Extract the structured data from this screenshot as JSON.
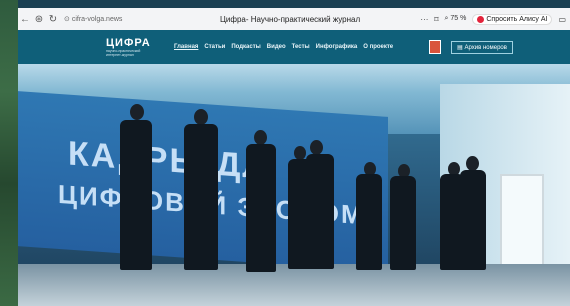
{
  "browser": {
    "address": "cifra-volga.news",
    "tab_title": "Цифра- Научно-практический журнал",
    "zoom": "75 %",
    "alice_button": "Спросить Алису AI"
  },
  "site": {
    "logo_title": "ЦИФРА",
    "logo_subtitle": "научно-практический интернет-журнал",
    "nav": [
      "Главная",
      "Статьи",
      "Подкасты",
      "Видео",
      "Тесты",
      "Инфографика",
      "О проекте"
    ],
    "archive_button": "Архив номеров"
  },
  "hero": {
    "screen_line1": "КАДРЫ ДЛ",
    "screen_line2": "ЦИФРОВОЙ ЭКОНОМИ"
  }
}
